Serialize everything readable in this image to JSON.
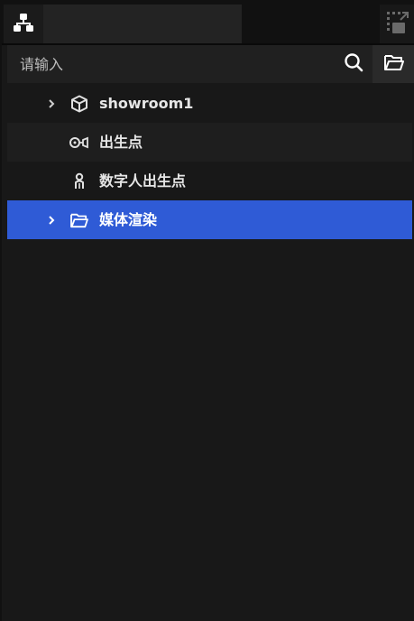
{
  "search": {
    "placeholder": "请输入"
  },
  "tree": {
    "items": [
      {
        "label": "showroom1",
        "icon": "cube-icon",
        "expandable": true
      },
      {
        "label": "出生点",
        "icon": "spawn-point-icon",
        "expandable": false
      },
      {
        "label": "数字人出生点",
        "icon": "digital-human-icon",
        "expandable": false
      },
      {
        "label": "媒体渲染",
        "icon": "folder-icon",
        "expandable": true,
        "selected": true
      }
    ]
  },
  "colors": {
    "panel_bg": "#181818",
    "selected_bg": "#2f5bd6",
    "text": "#e6e6e6"
  }
}
